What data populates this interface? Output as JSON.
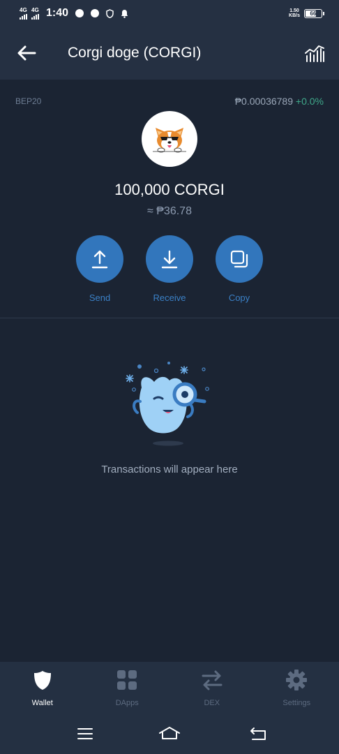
{
  "status_bar": {
    "net1": "4G",
    "net2": "4G",
    "time": "1:40",
    "speed_value": "1.50",
    "speed_unit": "KB/s",
    "battery": "66"
  },
  "header": {
    "title": "Corgi doge (CORGI)",
    "back_icon": "arrow-left-icon",
    "chart_icon": "price-chart-icon"
  },
  "token": {
    "network": "BEP20",
    "price": "₱0.00036789",
    "change": "+0.0%",
    "balance": "100,000 CORGI",
    "fiat_value": "≈ ₱36.78",
    "logo_icon": "corgi-logo-icon"
  },
  "actions": [
    {
      "label": "Send",
      "icon": "upload-arrow-icon"
    },
    {
      "label": "Receive",
      "icon": "download-arrow-icon"
    },
    {
      "label": "Copy",
      "icon": "copy-icon"
    }
  ],
  "empty_state": {
    "message": "Transactions will appear here",
    "illustration": "magnifier-mascot-icon"
  },
  "bottom_nav": [
    {
      "label": "Wallet",
      "icon": "shield-icon",
      "active": true
    },
    {
      "label": "DApps",
      "icon": "grid-icon",
      "active": false
    },
    {
      "label": "DEX",
      "icon": "swap-arrows-icon",
      "active": false
    },
    {
      "label": "Settings",
      "icon": "gear-icon",
      "active": false
    }
  ],
  "system_nav": [
    "menu-icon",
    "home-icon",
    "back-icon"
  ],
  "colors": {
    "background": "#1b2433",
    "header": "#253042",
    "accent": "#3276bc",
    "positive": "#3fa88a"
  }
}
